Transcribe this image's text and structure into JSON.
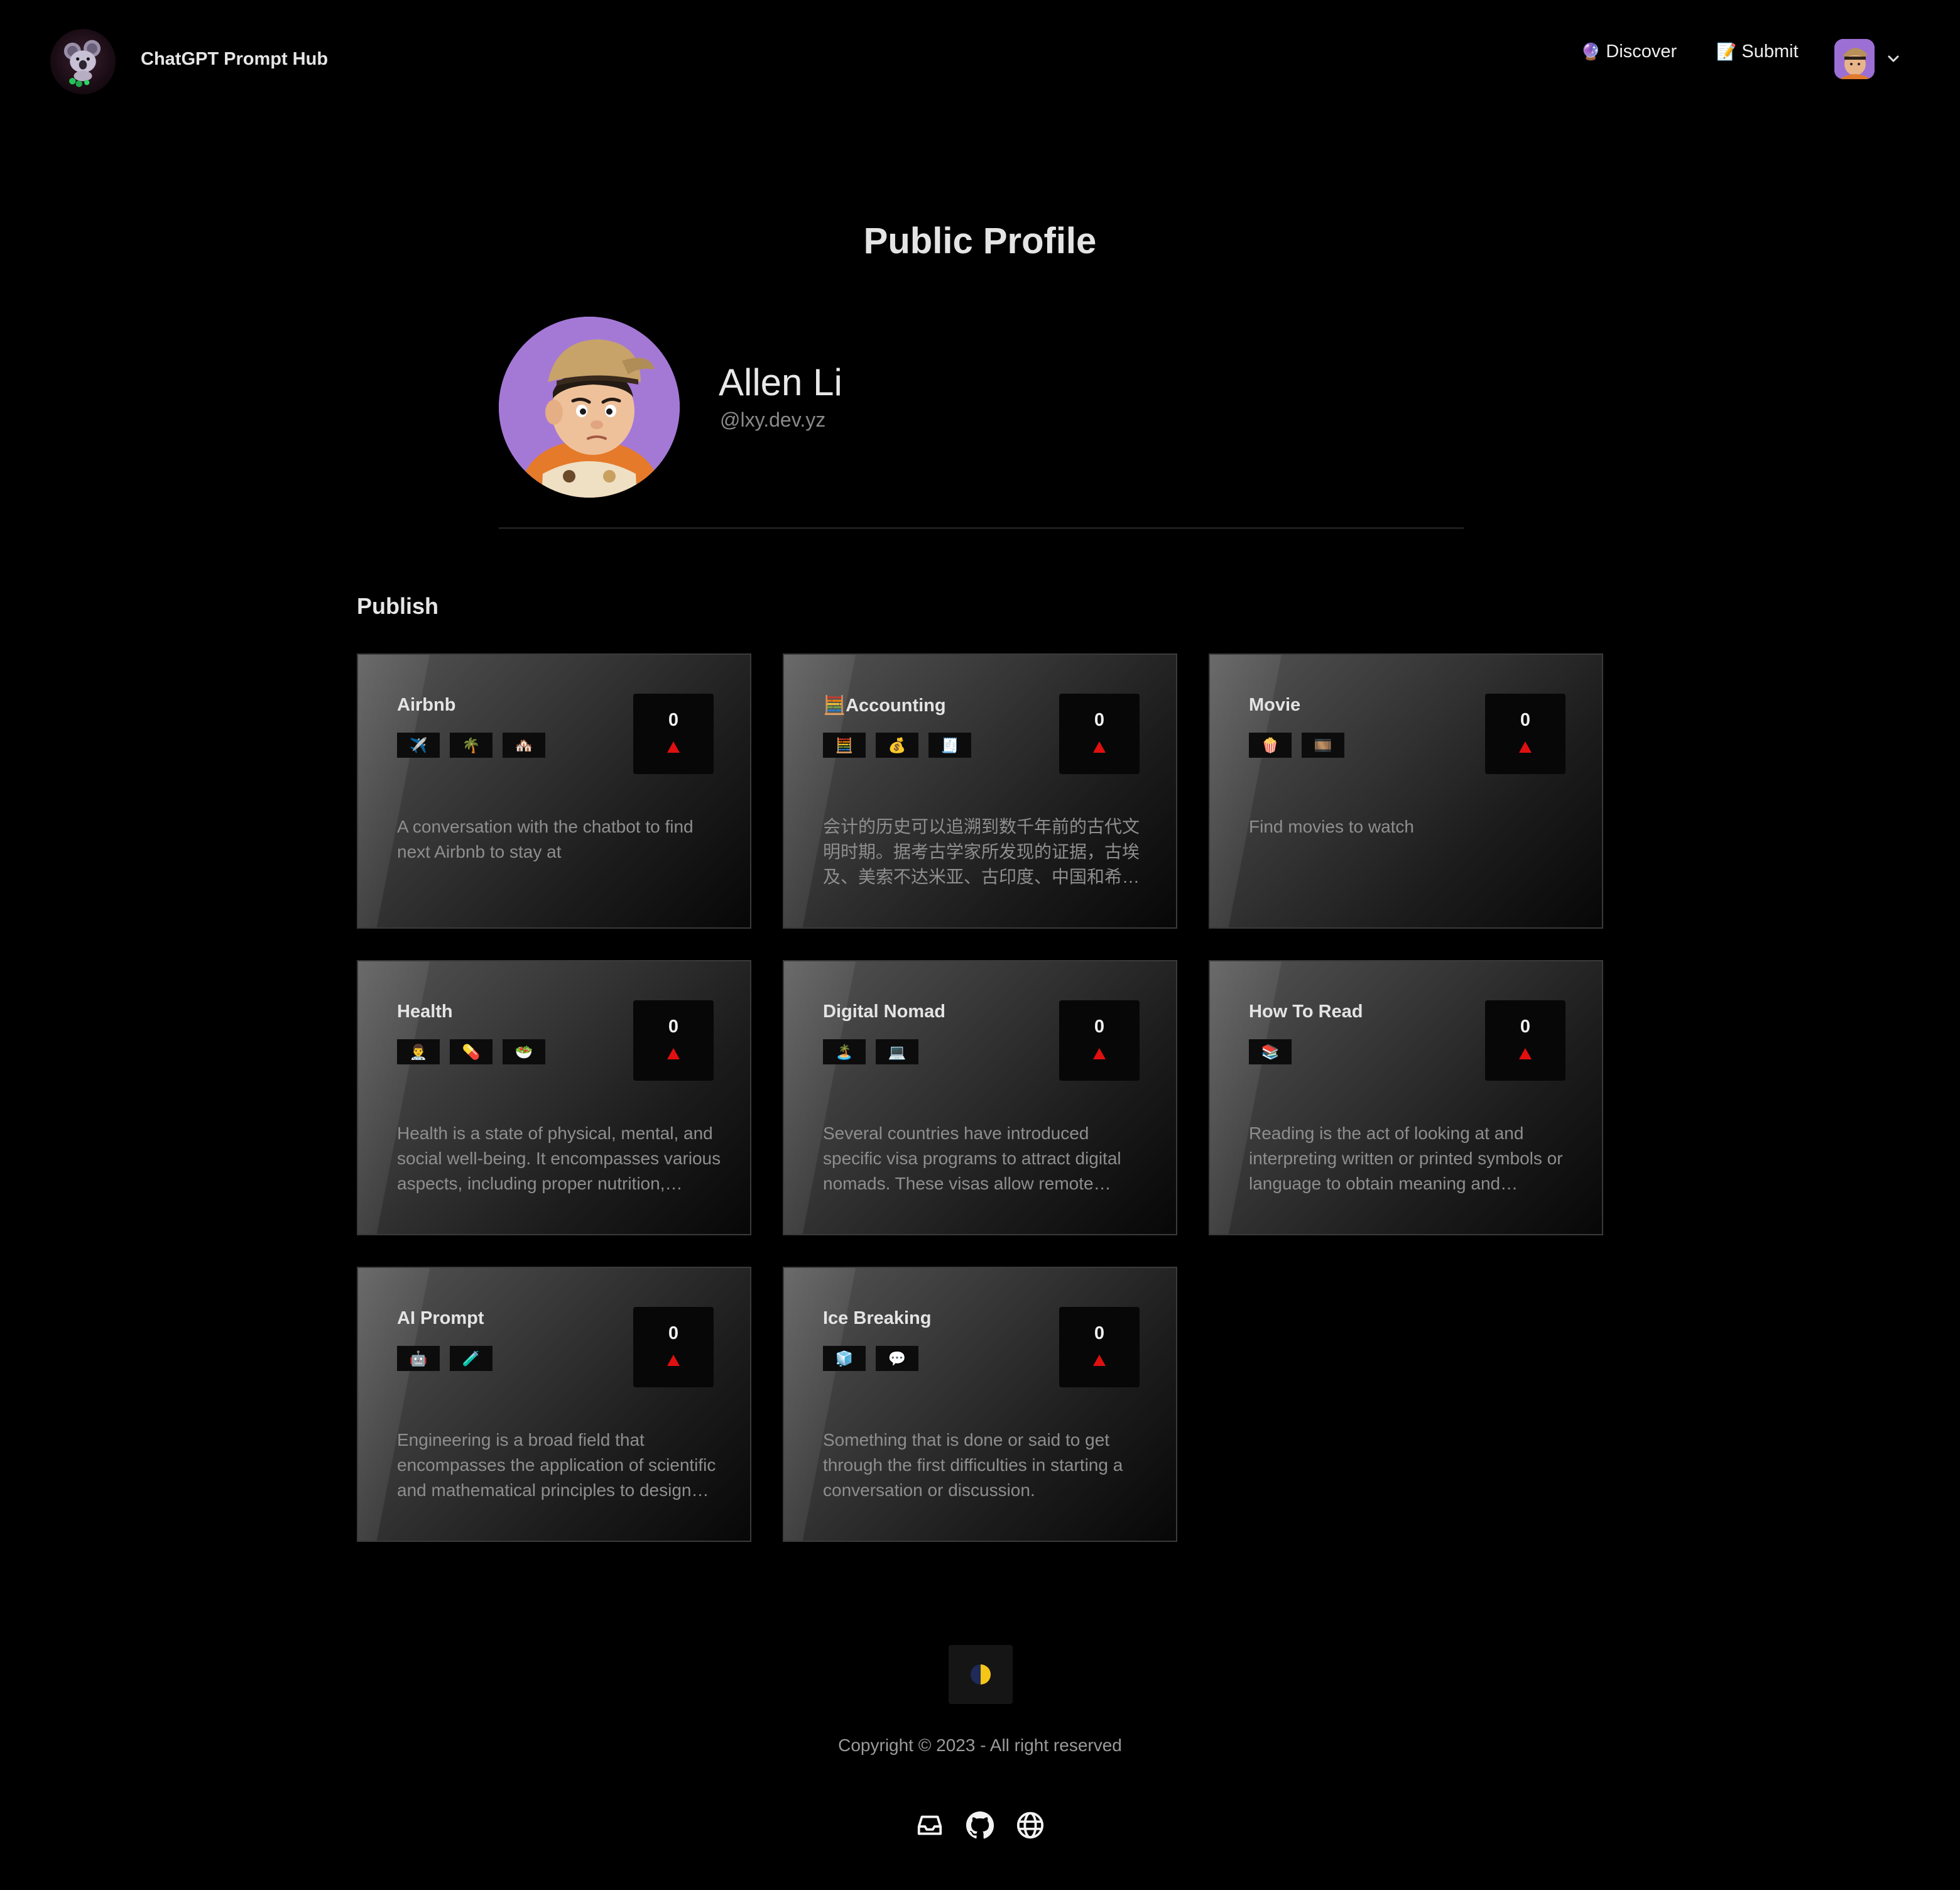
{
  "header": {
    "brand": "ChatGPT Prompt Hub",
    "nav": [
      {
        "icon": "crystal-ball-icon",
        "emoji": "🔮",
        "label": "Discover"
      },
      {
        "icon": "memo-icon",
        "emoji": "📝",
        "label": "Submit"
      }
    ]
  },
  "profile": {
    "page_title": "Public Profile",
    "name": "Allen Li",
    "handle": "@lxy.dev.yz"
  },
  "publish": {
    "title": "Publish",
    "cards": [
      {
        "title": "Airbnb",
        "title_emoji": "",
        "tags": [
          "✈️",
          "🌴",
          "🏘️"
        ],
        "votes": "0",
        "description": "A conversation with the chatbot to find next Airbnb to stay at"
      },
      {
        "title": "Accounting",
        "title_emoji": "🧮",
        "tags": [
          "🧮",
          "💰",
          "🧾"
        ],
        "votes": "0",
        "description": "会计的历史可以追溯到数千年前的古代文明时期。据考古学家所发现的证据，古埃及、美索不达米亚、古印度、中国和希腊等古代文明都有会计记录。"
      },
      {
        "title": "Movie",
        "title_emoji": "",
        "tags": [
          "🍿",
          "🎞️"
        ],
        "votes": "0",
        "description": "Find movies to watch"
      },
      {
        "title": "Health",
        "title_emoji": "",
        "tags": [
          "👨‍⚕️",
          "💊",
          "🥗"
        ],
        "votes": "0",
        "description": "Health is a state of physical, mental, and social well-being. It encompasses various aspects, including proper nutrition, exercise and rest."
      },
      {
        "title": "Digital Nomad",
        "title_emoji": "",
        "tags": [
          "🏝️",
          "💻"
        ],
        "votes": "0",
        "description": "Several countries have introduced specific visa programs to attract digital nomads. These visas allow remote workers to stay longer."
      },
      {
        "title": "How To Read",
        "title_emoji": "",
        "tags": [
          "📚"
        ],
        "votes": "0",
        "description": "Reading is the act of looking at and interpreting written or printed symbols or language to obtain meaning and information."
      },
      {
        "title": "AI Prompt",
        "title_emoji": "",
        "tags": [
          "🤖",
          "🧪"
        ],
        "votes": "0",
        "description": "Engineering is a broad field that encompasses the application of scientific and mathematical principles to design and build."
      },
      {
        "title": "Ice Breaking",
        "title_emoji": "",
        "tags": [
          "🧊",
          "💬"
        ],
        "votes": "0",
        "description": "Something that is done or said to get through the first difficulties in starting a conversation or discussion."
      }
    ]
  },
  "footer": {
    "theme_toggle_icon": "half-moon-icon",
    "copyright": "Copyright © 2023 - All right reserved",
    "social_icons": [
      "inbox-icon",
      "github-icon",
      "globe-icon"
    ]
  },
  "colors": {
    "background": "#000000",
    "vote_arrow": "#e01010",
    "avatar_purple": "#a479d6"
  }
}
